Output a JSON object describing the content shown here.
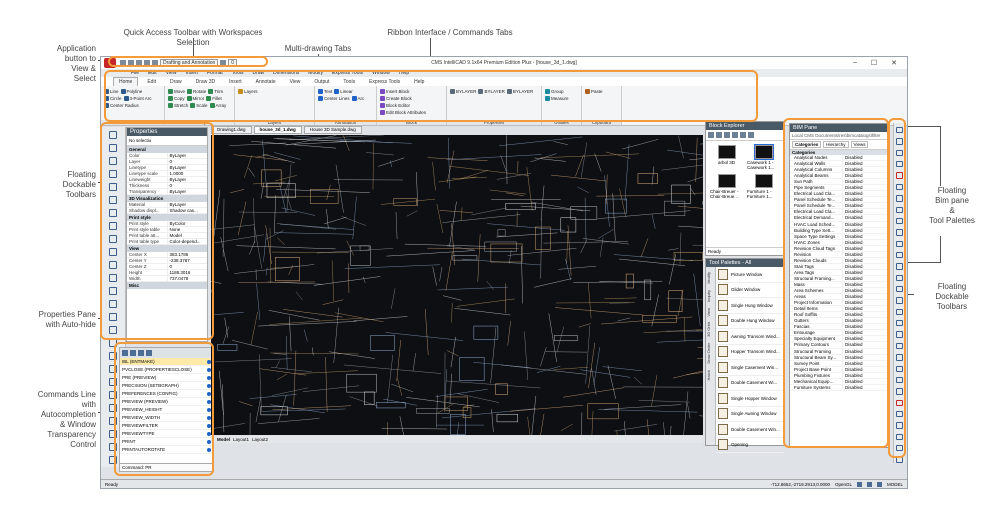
{
  "callouts": {
    "qat": "Quick Access Toolbar with Workspaces Selection",
    "ribbon": "Ribbon Interface / Commands Tabs",
    "app_button": [
      "Application",
      "button to",
      "View &",
      "Select"
    ],
    "multidoc": "Multi-drawing Tabs",
    "floating_left": [
      "Floating",
      "Dockable",
      "Toolbars"
    ],
    "properties": [
      "Properties Pane",
      "with Auto-hide"
    ],
    "commands": [
      "Commands Line",
      "with",
      "Autocompletion",
      "& Window",
      "Transparency",
      "Control"
    ],
    "bim": [
      "Floating",
      "Bim pane",
      "&",
      "Tool Palettes"
    ],
    "floating_right": [
      "Floating",
      "Dockable",
      "Toolbars"
    ]
  },
  "window": {
    "title": "CMS IntelliCAD 9.1x64 Premium Edition Plus - [house_3d_1.dwg]",
    "workspace": "Drafting and Annotation",
    "layer_value": "0",
    "controls": [
      "–",
      "☐",
      "✕"
    ]
  },
  "menu": [
    "File",
    "Edit",
    "View",
    "Insert",
    "Format",
    "Tools",
    "Draw",
    "Dimensions",
    "Modify",
    "Express Tools",
    "Window",
    "Help"
  ],
  "ribbon_tabs": [
    "Home",
    "Edit",
    "Draw",
    "Draw 3D",
    "Insert",
    "Annotate",
    "View",
    "Output",
    "Tools",
    "Express Tools",
    "Help"
  ],
  "ribbon_groups": [
    {
      "label": "Draw",
      "items": [
        "Line",
        "Polyline",
        "Circle",
        "3-Point Arc",
        "Center Radius"
      ]
    },
    {
      "label": "Modify",
      "items": [
        "Move",
        "Rotate",
        "Trim",
        "Copy",
        "Mirror",
        "Fillet",
        "Stretch",
        "Scale",
        "Array"
      ]
    },
    {
      "label": "Layers",
      "items": [
        "Layers"
      ]
    },
    {
      "label": "Annotation",
      "items": [
        "Text",
        "Linear",
        "Center Lines",
        "Arc"
      ]
    },
    {
      "label": "Block",
      "items": [
        "Insert Block",
        "Create Block",
        "Block Editor",
        "Edit Block Attributes"
      ]
    },
    {
      "label": "Properties",
      "items": [
        "BYLAYER",
        "BYLAYER",
        "BYLAYER"
      ]
    },
    {
      "label": "Utilities",
      "items": [
        "Group",
        "Measure"
      ]
    },
    {
      "label": "Clipboard",
      "items": [
        "Paste"
      ]
    }
  ],
  "properties": {
    "title": "Properties",
    "selection": "No selectio",
    "categories": [
      {
        "name": "General",
        "rows": [
          [
            "Color",
            "ByLayer"
          ],
          [
            "Layer",
            "0"
          ],
          [
            "Linetype",
            "ByLayer"
          ],
          [
            "Linetype scale",
            "1.0000"
          ],
          [
            "Lineweight",
            "ByLayer"
          ],
          [
            "Thickness",
            "0"
          ],
          [
            "Transparency",
            "ByLayer"
          ]
        ]
      },
      {
        "name": "3D Visualization",
        "rows": [
          [
            "Material",
            "ByLayer"
          ],
          [
            "Shadow displ...",
            "Shadow cas..."
          ]
        ]
      },
      {
        "name": "Print style",
        "rows": [
          [
            "Print style",
            "ByColor"
          ],
          [
            "Print style table",
            "None"
          ],
          [
            "Print table att...",
            "Model"
          ],
          [
            "Print table type",
            "Color-depend..."
          ]
        ]
      },
      {
        "name": "View",
        "rows": [
          [
            "Center X",
            "383.1786"
          ],
          [
            "Center Y",
            "-238.3787"
          ],
          [
            "Center Z",
            "0"
          ],
          [
            "Height",
            "1188.3016"
          ],
          [
            "Width",
            "737.0478"
          ]
        ]
      },
      {
        "name": "Misc",
        "rows": []
      }
    ]
  },
  "commands": {
    "items": [
      "IBL (ENTMAKE)",
      "PVCLOSE (PROPERTIESCLOSE)",
      "PRE (PREVIEW)",
      "PRECISION (SETBGRAPH)",
      "PREFERENCES (CONFIG)",
      "PREVIEW (PREVIEW)",
      "PREVIEW_HEIGHT",
      "PREVIEW_WIDTH",
      "PREVIEWFILTER",
      "PREVIEWTYPE",
      "PRINT",
      "PRINTAUTOROTATE"
    ],
    "input": "Command: PR"
  },
  "doc_tabs": [
    "Drawing1.dwg",
    "house_3d_1.dwg",
    "House 3D Sample.dwg"
  ],
  "layout_tabs": [
    "Model",
    "Layout1",
    "Layout2"
  ],
  "block_explorer": {
    "title": "Block Explorer",
    "blocks": [
      "arbol 3D",
      "Casework 1 - Casework 1...",
      "Chair-Breuer - Chair-Breue...",
      "Furniture 1 - Furniture 1..."
    ],
    "status": "Ready"
  },
  "tool_palettes": {
    "title": "Tool Palettes - All",
    "tabs": [
      "Modify",
      "Inquiry",
      "View",
      "3D Orbit",
      "Draw Order",
      "Hatch"
    ],
    "items": [
      "Picture Window",
      "Glider Window",
      "Single Hung Window",
      "Double Hung Window",
      "Awning Transom Wind...",
      "Hopper Transom Wind...",
      "Single Casement Win...",
      "Double Casement Wi...",
      "Single Hopper Window",
      "Single Awning Window",
      "Double Casement Win...",
      "Opening"
    ]
  },
  "bim": {
    "title": "BIM Pane",
    "path": "Local CMS Documents\\res\\bimcatalogs\\filter",
    "tabs": [
      "Categories",
      "Hierarchy",
      "Views"
    ],
    "root": "Categories",
    "rows": [
      [
        "Analytical Nodes",
        "Disabled"
      ],
      [
        "Analytical Walls",
        "Disabled"
      ],
      [
        "Analytical Columns",
        "Disabled"
      ],
      [
        "Analytical Beams",
        "Disabled"
      ],
      [
        "Sun Path",
        "Disabled"
      ],
      [
        "Pipe Segments",
        "Disabled"
      ],
      [
        "Electrical Load Cla...",
        "Disabled"
      ],
      [
        "Panel Schedule Te...",
        "Disabled"
      ],
      [
        "Panel Schedule Te...",
        "Disabled"
      ],
      [
        "Electrical Load Cla...",
        "Disabled"
      ],
      [
        "Electrical Demand...",
        "Disabled"
      ],
      [
        "HVAC Load Sched...",
        "Disabled"
      ],
      [
        "Building Type Sett...",
        "Disabled"
      ],
      [
        "Space Type Settings",
        "Disabled"
      ],
      [
        "HVAC Zones",
        "Disabled"
      ],
      [
        "Revision Cloud Tags",
        "Disabled"
      ],
      [
        "Revision",
        "Disabled"
      ],
      [
        "Revision Clouds",
        "Disabled"
      ],
      [
        "Stair Tags",
        "Disabled"
      ],
      [
        "Area Tags",
        "Disabled"
      ],
      [
        "Structural Framing...",
        "Disabled"
      ],
      [
        "Mass",
        "Disabled"
      ],
      [
        "Area Schemes",
        "Disabled"
      ],
      [
        "Areas",
        "Disabled"
      ],
      [
        "Project Information",
        "Disabled"
      ],
      [
        "Detail Items",
        "Disabled"
      ],
      [
        "Roof Soffits",
        "Disabled"
      ],
      [
        "Gutters",
        "Disabled"
      ],
      [
        "Fascias",
        "Disabled"
      ],
      [
        "Entourage",
        "Disabled"
      ],
      [
        "Specialty Equipment",
        "Disabled"
      ],
      [
        "Primary Contours",
        "Disabled"
      ],
      [
        "Structural Framing",
        "Disabled"
      ],
      [
        "Structural Beam Sy...",
        "Disabled"
      ],
      [
        "Survey Point",
        "Disabled"
      ],
      [
        "Project Base Point",
        "Disabled"
      ],
      [
        "Plumbing Fixtures",
        "Disabled"
      ],
      [
        "Mechanical Equip...",
        "Disabled"
      ],
      [
        "Furniture Systems",
        "Disabled"
      ]
    ]
  },
  "status": {
    "left": "Ready",
    "coords": "-712.8652,-2719.2913,0.0000",
    "opengl": "OpenGL",
    "model": "MODEL"
  },
  "colors": {
    "accent": "#f39a3a",
    "viewport_bg": "#0d0f12",
    "panel_header": "#4a5966"
  }
}
